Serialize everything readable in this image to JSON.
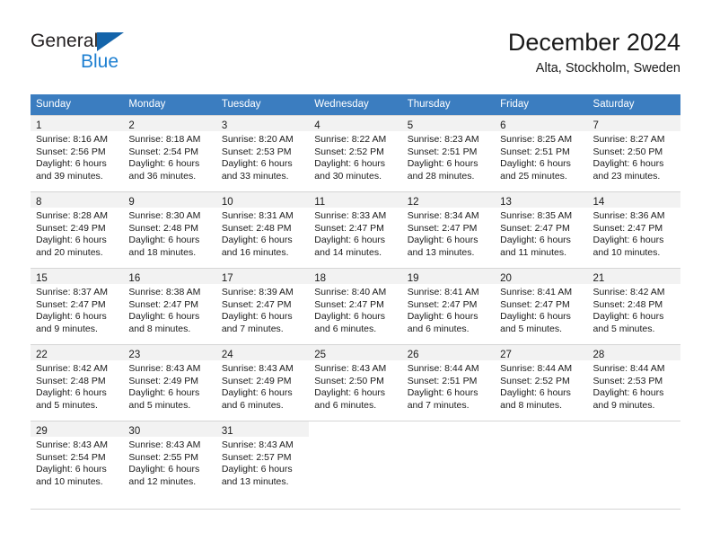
{
  "brand": {
    "name_part1": "General",
    "name_part2": "Blue",
    "triangle_color": "#1464aa",
    "blue_color": "#1d7fd1"
  },
  "header": {
    "title": "December 2024",
    "subtitle": "Alta, Stockholm, Sweden"
  },
  "theme": {
    "header_bar_color": "#3b7dc0",
    "daynum_band_color": "#f2f2f2",
    "grid_line_color": "#d5d5d5"
  },
  "weekdays": [
    "Sunday",
    "Monday",
    "Tuesday",
    "Wednesday",
    "Thursday",
    "Friday",
    "Saturday"
  ],
  "weeks": [
    [
      {
        "day": "1",
        "sunrise": "Sunrise: 8:16 AM",
        "sunset": "Sunset: 2:56 PM",
        "daylight1": "Daylight: 6 hours",
        "daylight2": "and 39 minutes."
      },
      {
        "day": "2",
        "sunrise": "Sunrise: 8:18 AM",
        "sunset": "Sunset: 2:54 PM",
        "daylight1": "Daylight: 6 hours",
        "daylight2": "and 36 minutes."
      },
      {
        "day": "3",
        "sunrise": "Sunrise: 8:20 AM",
        "sunset": "Sunset: 2:53 PM",
        "daylight1": "Daylight: 6 hours",
        "daylight2": "and 33 minutes."
      },
      {
        "day": "4",
        "sunrise": "Sunrise: 8:22 AM",
        "sunset": "Sunset: 2:52 PM",
        "daylight1": "Daylight: 6 hours",
        "daylight2": "and 30 minutes."
      },
      {
        "day": "5",
        "sunrise": "Sunrise: 8:23 AM",
        "sunset": "Sunset: 2:51 PM",
        "daylight1": "Daylight: 6 hours",
        "daylight2": "and 28 minutes."
      },
      {
        "day": "6",
        "sunrise": "Sunrise: 8:25 AM",
        "sunset": "Sunset: 2:51 PM",
        "daylight1": "Daylight: 6 hours",
        "daylight2": "and 25 minutes."
      },
      {
        "day": "7",
        "sunrise": "Sunrise: 8:27 AM",
        "sunset": "Sunset: 2:50 PM",
        "daylight1": "Daylight: 6 hours",
        "daylight2": "and 23 minutes."
      }
    ],
    [
      {
        "day": "8",
        "sunrise": "Sunrise: 8:28 AM",
        "sunset": "Sunset: 2:49 PM",
        "daylight1": "Daylight: 6 hours",
        "daylight2": "and 20 minutes."
      },
      {
        "day": "9",
        "sunrise": "Sunrise: 8:30 AM",
        "sunset": "Sunset: 2:48 PM",
        "daylight1": "Daylight: 6 hours",
        "daylight2": "and 18 minutes."
      },
      {
        "day": "10",
        "sunrise": "Sunrise: 8:31 AM",
        "sunset": "Sunset: 2:48 PM",
        "daylight1": "Daylight: 6 hours",
        "daylight2": "and 16 minutes."
      },
      {
        "day": "11",
        "sunrise": "Sunrise: 8:33 AM",
        "sunset": "Sunset: 2:47 PM",
        "daylight1": "Daylight: 6 hours",
        "daylight2": "and 14 minutes."
      },
      {
        "day": "12",
        "sunrise": "Sunrise: 8:34 AM",
        "sunset": "Sunset: 2:47 PM",
        "daylight1": "Daylight: 6 hours",
        "daylight2": "and 13 minutes."
      },
      {
        "day": "13",
        "sunrise": "Sunrise: 8:35 AM",
        "sunset": "Sunset: 2:47 PM",
        "daylight1": "Daylight: 6 hours",
        "daylight2": "and 11 minutes."
      },
      {
        "day": "14",
        "sunrise": "Sunrise: 8:36 AM",
        "sunset": "Sunset: 2:47 PM",
        "daylight1": "Daylight: 6 hours",
        "daylight2": "and 10 minutes."
      }
    ],
    [
      {
        "day": "15",
        "sunrise": "Sunrise: 8:37 AM",
        "sunset": "Sunset: 2:47 PM",
        "daylight1": "Daylight: 6 hours",
        "daylight2": "and 9 minutes."
      },
      {
        "day": "16",
        "sunrise": "Sunrise: 8:38 AM",
        "sunset": "Sunset: 2:47 PM",
        "daylight1": "Daylight: 6 hours",
        "daylight2": "and 8 minutes."
      },
      {
        "day": "17",
        "sunrise": "Sunrise: 8:39 AM",
        "sunset": "Sunset: 2:47 PM",
        "daylight1": "Daylight: 6 hours",
        "daylight2": "and 7 minutes."
      },
      {
        "day": "18",
        "sunrise": "Sunrise: 8:40 AM",
        "sunset": "Sunset: 2:47 PM",
        "daylight1": "Daylight: 6 hours",
        "daylight2": "and 6 minutes."
      },
      {
        "day": "19",
        "sunrise": "Sunrise: 8:41 AM",
        "sunset": "Sunset: 2:47 PM",
        "daylight1": "Daylight: 6 hours",
        "daylight2": "and 6 minutes."
      },
      {
        "day": "20",
        "sunrise": "Sunrise: 8:41 AM",
        "sunset": "Sunset: 2:47 PM",
        "daylight1": "Daylight: 6 hours",
        "daylight2": "and 5 minutes."
      },
      {
        "day": "21",
        "sunrise": "Sunrise: 8:42 AM",
        "sunset": "Sunset: 2:48 PM",
        "daylight1": "Daylight: 6 hours",
        "daylight2": "and 5 minutes."
      }
    ],
    [
      {
        "day": "22",
        "sunrise": "Sunrise: 8:42 AM",
        "sunset": "Sunset: 2:48 PM",
        "daylight1": "Daylight: 6 hours",
        "daylight2": "and 5 minutes."
      },
      {
        "day": "23",
        "sunrise": "Sunrise: 8:43 AM",
        "sunset": "Sunset: 2:49 PM",
        "daylight1": "Daylight: 6 hours",
        "daylight2": "and 5 minutes."
      },
      {
        "day": "24",
        "sunrise": "Sunrise: 8:43 AM",
        "sunset": "Sunset: 2:49 PM",
        "daylight1": "Daylight: 6 hours",
        "daylight2": "and 6 minutes."
      },
      {
        "day": "25",
        "sunrise": "Sunrise: 8:43 AM",
        "sunset": "Sunset: 2:50 PM",
        "daylight1": "Daylight: 6 hours",
        "daylight2": "and 6 minutes."
      },
      {
        "day": "26",
        "sunrise": "Sunrise: 8:44 AM",
        "sunset": "Sunset: 2:51 PM",
        "daylight1": "Daylight: 6 hours",
        "daylight2": "and 7 minutes."
      },
      {
        "day": "27",
        "sunrise": "Sunrise: 8:44 AM",
        "sunset": "Sunset: 2:52 PM",
        "daylight1": "Daylight: 6 hours",
        "daylight2": "and 8 minutes."
      },
      {
        "day": "28",
        "sunrise": "Sunrise: 8:44 AM",
        "sunset": "Sunset: 2:53 PM",
        "daylight1": "Daylight: 6 hours",
        "daylight2": "and 9 minutes."
      }
    ],
    [
      {
        "day": "29",
        "sunrise": "Sunrise: 8:43 AM",
        "sunset": "Sunset: 2:54 PM",
        "daylight1": "Daylight: 6 hours",
        "daylight2": "and 10 minutes."
      },
      {
        "day": "30",
        "sunrise": "Sunrise: 8:43 AM",
        "sunset": "Sunset: 2:55 PM",
        "daylight1": "Daylight: 6 hours",
        "daylight2": "and 12 minutes."
      },
      {
        "day": "31",
        "sunrise": "Sunrise: 8:43 AM",
        "sunset": "Sunset: 2:57 PM",
        "daylight1": "Daylight: 6 hours",
        "daylight2": "and 13 minutes."
      },
      {
        "day": "",
        "sunrise": "",
        "sunset": "",
        "daylight1": "",
        "daylight2": ""
      },
      {
        "day": "",
        "sunrise": "",
        "sunset": "",
        "daylight1": "",
        "daylight2": ""
      },
      {
        "day": "",
        "sunrise": "",
        "sunset": "",
        "daylight1": "",
        "daylight2": ""
      },
      {
        "day": "",
        "sunrise": "",
        "sunset": "",
        "daylight1": "",
        "daylight2": ""
      }
    ]
  ]
}
